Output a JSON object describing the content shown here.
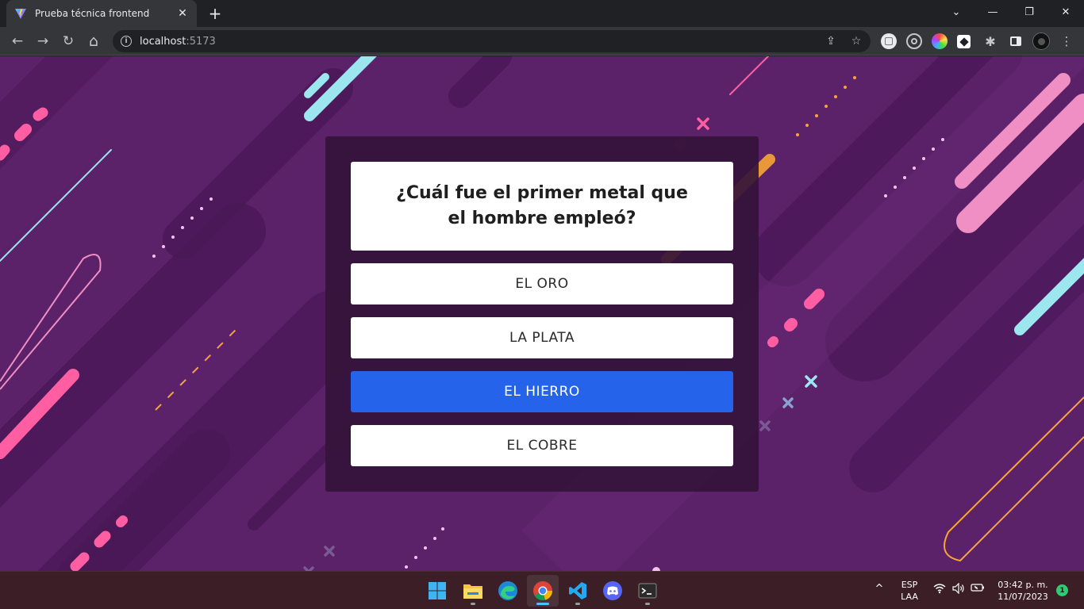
{
  "browser": {
    "tab_title": "Prueba técnica frontend",
    "tab_close": "✕",
    "new_tab": "+",
    "url_host": "localhost",
    "url_port": ":5173",
    "window_controls": {
      "tabs_menu": "⌄",
      "minimize": "—",
      "restore": "❐",
      "close": "✕"
    },
    "nav": {
      "back": "←",
      "forward": "→",
      "reload": "↻",
      "home": "⌂"
    },
    "info": "i"
  },
  "quiz": {
    "question": "¿Cuál fue el primer metal que el hombre empleó?",
    "answers": [
      {
        "label": "EL ORO",
        "selected": false
      },
      {
        "label": "LA PLATA",
        "selected": false
      },
      {
        "label": "EL HIERRO",
        "selected": true
      },
      {
        "label": "EL COBRE",
        "selected": false
      }
    ]
  },
  "taskbar": {
    "language_top": "ESP",
    "language_bottom": "LAA",
    "time": "03:42 p. m.",
    "date": "11/07/2023",
    "notification_count": "1",
    "tray_chevron": "^"
  },
  "colors": {
    "page_bg": "#5b2169",
    "card_bg": "#34143a",
    "selected_answer": "#2563eb",
    "accent_pink": "#ff5fa2",
    "accent_cyan": "#9be6ef",
    "accent_orange": "#f7a635"
  }
}
